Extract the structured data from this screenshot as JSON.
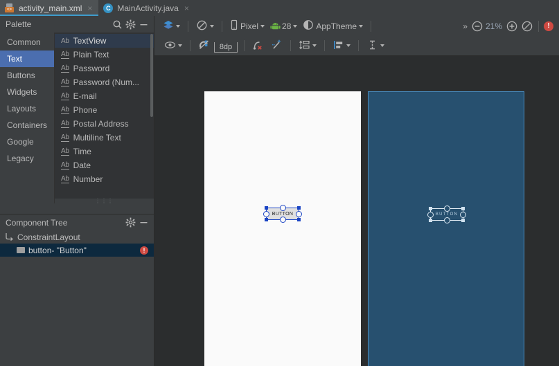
{
  "tabs": [
    {
      "label": "activity_main.xml",
      "icon": "xml-file-icon",
      "active": true,
      "close": "×"
    },
    {
      "label": "MainActivity.java",
      "icon": "java-class-icon",
      "active": false,
      "close": "×"
    }
  ],
  "palette": {
    "title": "Palette",
    "search_icon": "search-icon",
    "gear_icon": "gear-icon",
    "minimize_icon": "minimize-icon",
    "categories": [
      {
        "label": "Common",
        "selected": false
      },
      {
        "label": "Text",
        "selected": true
      },
      {
        "label": "Buttons",
        "selected": false
      },
      {
        "label": "Widgets",
        "selected": false
      },
      {
        "label": "Layouts",
        "selected": false
      },
      {
        "label": "Containers",
        "selected": false
      },
      {
        "label": "Google",
        "selected": false
      },
      {
        "label": "Legacy",
        "selected": false
      }
    ],
    "items": [
      {
        "label": "TextView",
        "icon": "Ab",
        "underline": false,
        "selected": true
      },
      {
        "label": "Plain Text",
        "icon": "Ab",
        "underline": true,
        "selected": false
      },
      {
        "label": "Password",
        "icon": "Ab",
        "underline": true,
        "selected": false
      },
      {
        "label": "Password (Num...",
        "icon": "Ab",
        "underline": true,
        "selected": false
      },
      {
        "label": "E-mail",
        "icon": "Ab",
        "underline": true,
        "selected": false
      },
      {
        "label": "Phone",
        "icon": "Ab",
        "underline": true,
        "selected": false
      },
      {
        "label": "Postal Address",
        "icon": "Ab",
        "underline": true,
        "selected": false
      },
      {
        "label": "Multiline Text",
        "icon": "Ab",
        "underline": true,
        "selected": false
      },
      {
        "label": "Time",
        "icon": "Ab",
        "underline": true,
        "selected": false
      },
      {
        "label": "Date",
        "icon": "Ab",
        "underline": true,
        "selected": false
      },
      {
        "label": "Number",
        "icon": "Ab",
        "underline": true,
        "selected": false
      }
    ],
    "grip": "⋮⋮⋮"
  },
  "component_tree": {
    "title": "Component Tree",
    "gear_icon": "gear-icon",
    "minimize_icon": "minimize-icon",
    "rows": [
      {
        "label": "ConstraintLayout",
        "icon": "constraint-layout-icon",
        "selected": false,
        "error": false
      },
      {
        "label": "button- \"Button\"",
        "icon": "widget-icon",
        "selected": true,
        "error": true,
        "error_glyph": "!"
      }
    ]
  },
  "toolbar_main": {
    "design_mode_icon": "layers-icon",
    "orientation_icon": "rotate-icon",
    "device_icon": "phone-icon",
    "device_label": "Pixel",
    "api_icon": "android-icon",
    "api_label": "28",
    "theme_icon": "theme-icon",
    "theme_label": "AppTheme",
    "overflow": "»",
    "zoom_out_icon": "zoom-out-icon",
    "zoom_level": "21%",
    "zoom_in_icon": "zoom-in-icon",
    "zoom_fit_icon": "zoom-fit-icon",
    "error_icon": "error-icon",
    "error_glyph": "!"
  },
  "toolbar_constraints": {
    "visibility_icon": "eye-icon",
    "autoconnect_icon": "magnet-off-icon",
    "default_margin": "8dp",
    "clear_constraints_icon": "clear-constraints-icon",
    "infer_constraints_icon": "infer-constraints-icon",
    "pack_icon": "pack-icon",
    "align_icon": "align-icon",
    "guidelines_icon": "guidelines-icon"
  },
  "canvas": {
    "design_surface_name": "design-preview",
    "blueprint_surface_name": "blueprint-preview",
    "widget_design_label": "BUTTON",
    "widget_blueprint_label": "BUTTON",
    "blueprint_bg": "#27506f",
    "design_bg": "#fafafa",
    "selection_color": "#1a44c4"
  }
}
